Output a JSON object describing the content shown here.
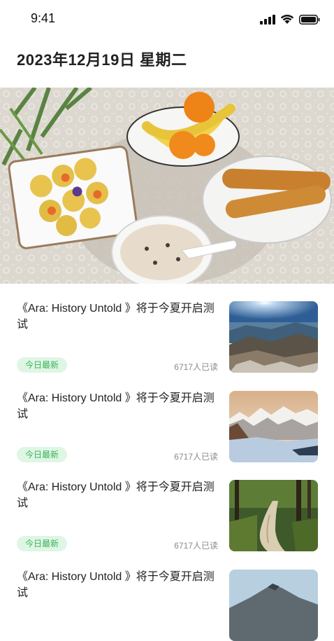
{
  "status_bar": {
    "time": "9:41",
    "icons": [
      "signal-icon",
      "wifi-icon",
      "battery-icon"
    ]
  },
  "header": {
    "title": "2023年12月19日 星期二"
  },
  "hero": {
    "image": "breakfast-photo"
  },
  "feed": {
    "items": [
      {
        "title": "《Ara: History Untold 》将于今夏开启测试",
        "tag": "今日最新",
        "reads": "6717人已读",
        "thumb": "mountain-sunrise-photo"
      },
      {
        "title": "《Ara: History Untold 》将于今夏开启测试",
        "tag": "今日最新",
        "reads": "6717人已读",
        "thumb": "snowy-mountains-photo"
      },
      {
        "title": "《Ara: History Untold 》将于今夏开启测试",
        "tag": "今日最新",
        "reads": "6717人已读",
        "thumb": "forest-path-photo"
      },
      {
        "title": "《Ara: History Untold 》将于今夏开启测试",
        "tag": "",
        "reads": "",
        "thumb": "mountain-peak-photo"
      }
    ]
  },
  "colors": {
    "tag_bg": "#dff6e4",
    "tag_text": "#3ab35b",
    "muted_text": "#8a8a8a"
  }
}
